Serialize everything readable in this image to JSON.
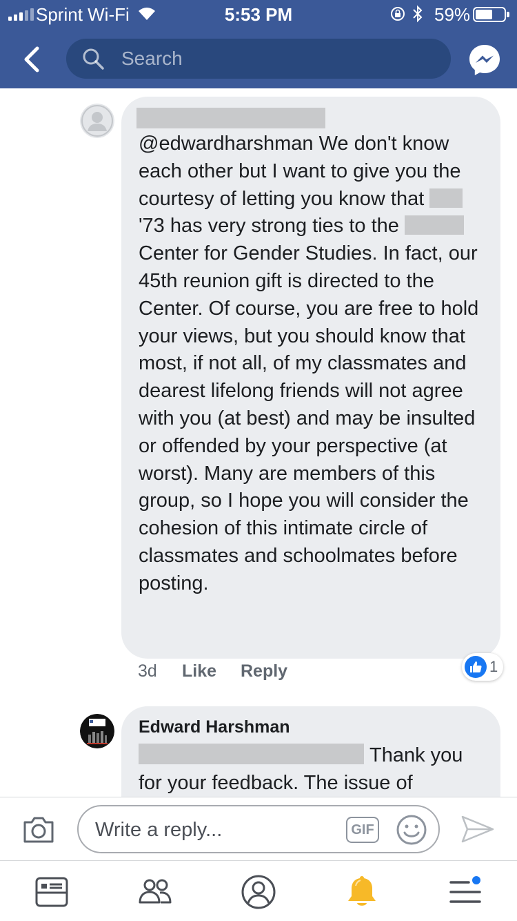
{
  "status_bar": {
    "carrier": "Sprint Wi-Fi",
    "time": "5:53 PM",
    "battery": "59%",
    "battery_level": 0.59
  },
  "nav": {
    "search_placeholder": "Search",
    "icons": [
      "back-chevron-icon",
      "search-icon",
      "messenger-icon"
    ]
  },
  "comments": [
    {
      "author": "",
      "text_parts": [
        "@edwardharshman We don't know each other but I want to give you the courtesy of letting you know that ",
        " '73 has very strong ties to the ",
        " Center for Gender Studies. In fact, our 45th reunion gift is directed to the Center. Of course, you are free to hold your views, but you should know that most, if not all, of my classmates and dearest lifelong friends will not agree with you (at best) and may be insulted or offended by your perspective (at worst). Many are members of this group, so I hope you will consider the cohesion of this intimate circle of classmates and schoolmates before posting."
      ],
      "time": "3d",
      "like_label": "Like",
      "reply_label": "Reply",
      "reaction_count": "1"
    },
    {
      "author": "Edward Harshman",
      "text": "Thank you for your feedback. The issue of"
    }
  ],
  "reply_bar": {
    "placeholder": "Write a reply...",
    "gif_label": "GIF",
    "icons": [
      "camera-icon",
      "emoji-icon",
      "send-icon"
    ]
  },
  "tab_bar": {
    "icons": [
      "news-feed-icon",
      "friends-icon",
      "profile-icon",
      "notifications-icon",
      "menu-icon"
    ],
    "colors": {
      "brand": "#3b5998",
      "notification": "#f7b928",
      "accent": "#1877f2"
    }
  }
}
